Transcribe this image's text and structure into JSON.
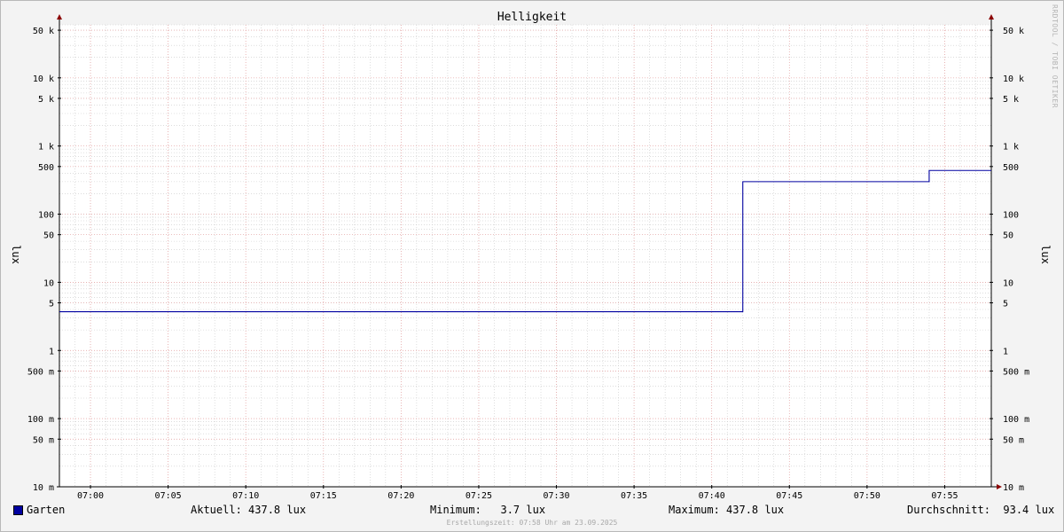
{
  "chart_data": {
    "type": "line",
    "title": "Helligkeit",
    "ylabel": "lux",
    "y_scale": "log",
    "ylim": [
      0.01,
      60000
    ],
    "xlim": [
      "06:58",
      "07:58"
    ],
    "y_ticks": [
      {
        "value": 50000,
        "label": "50 k"
      },
      {
        "value": 10000,
        "label": "10 k"
      },
      {
        "value": 5000,
        "label": "5 k"
      },
      {
        "value": 1000,
        "label": "1 k"
      },
      {
        "value": 500,
        "label": "500"
      },
      {
        "value": 100,
        "label": "100"
      },
      {
        "value": 50,
        "label": "50"
      },
      {
        "value": 10,
        "label": "10"
      },
      {
        "value": 5,
        "label": "5"
      },
      {
        "value": 1,
        "label": "1"
      },
      {
        "value": 0.5,
        "label": "500 m"
      },
      {
        "value": 0.1,
        "label": "100 m"
      },
      {
        "value": 0.05,
        "label": "50 m"
      },
      {
        "value": 0.01,
        "label": "10 m"
      }
    ],
    "x_ticks": [
      "07:00",
      "07:05",
      "07:10",
      "07:15",
      "07:20",
      "07:25",
      "07:30",
      "07:35",
      "07:40",
      "07:45",
      "07:50",
      "07:55"
    ],
    "grid": true,
    "series": [
      {
        "name": "Garten",
        "color": "#0000a0",
        "step": true,
        "points": [
          {
            "x": "06:58",
            "y": 3.7
          },
          {
            "x": "07:42",
            "y": 300
          },
          {
            "x": "07:54",
            "y": 437.8
          },
          {
            "x": "07:58",
            "y": 437.8
          }
        ]
      }
    ]
  },
  "legend": {
    "series_name": "Garten",
    "current": "Aktuell: 437.8 lux",
    "minimum": "Minimum:   3.7 lux",
    "maximum": "Maximum: 437.8 lux",
    "average": "Durchschnitt:  93.4 lux"
  },
  "footer": "Erstellungszeit: 07:58 Uhr am 23.09.2025",
  "watermark": "RRDTOOL / TOBI OETIKER",
  "colors": {
    "background": "#f3f3f3",
    "plot": "#ffffff",
    "line": "#0000a0",
    "major_grid": "#e8a0a0",
    "minor_grid": "#c8c8c8",
    "arrow": "#8b0000"
  }
}
